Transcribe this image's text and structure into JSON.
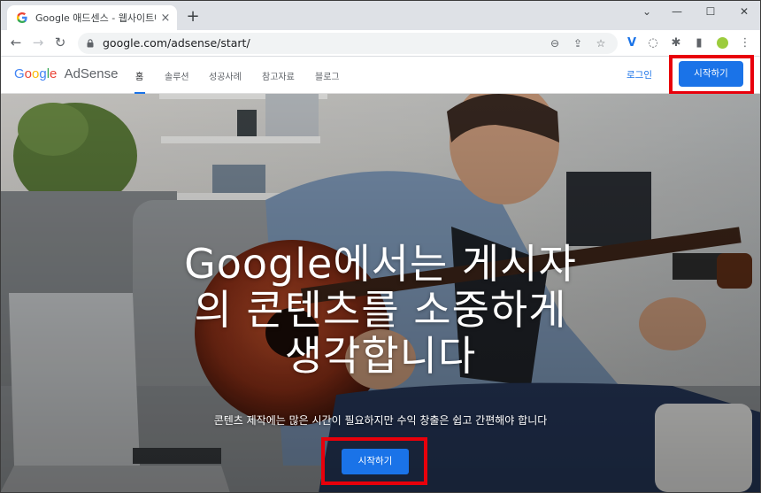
{
  "browser": {
    "tab_title": "Google 애드센스 - 웹사이트에서",
    "tab_close": "×",
    "new_tab": "+",
    "url": "google.com/adsense/start/",
    "minimize": "⌄",
    "min": "—",
    "max": "☐",
    "close": "✕"
  },
  "site": {
    "logo_google": [
      "G",
      "o",
      "o",
      "g",
      "l",
      "e"
    ],
    "logo_product": "AdSense",
    "nav": [
      {
        "label": "홈"
      },
      {
        "label": "솔루션"
      },
      {
        "label": "성공사례"
      },
      {
        "label": "참고자료"
      },
      {
        "label": "블로그"
      }
    ],
    "login": "로그인",
    "cta_top": "시작하기"
  },
  "hero": {
    "headline_line1": "Google에서는 게시자",
    "headline_line2": "의 콘텐츠를 소중하게",
    "headline_line3": "생각합니다",
    "subline": "콘텐츠 제작에는 많은 시간이 필요하지만 수익 창출은 쉽고 간편해야 합니다",
    "cta": "시작하기"
  },
  "colors": {
    "accent": "#1a73e8",
    "highlight": "#e8000b"
  }
}
